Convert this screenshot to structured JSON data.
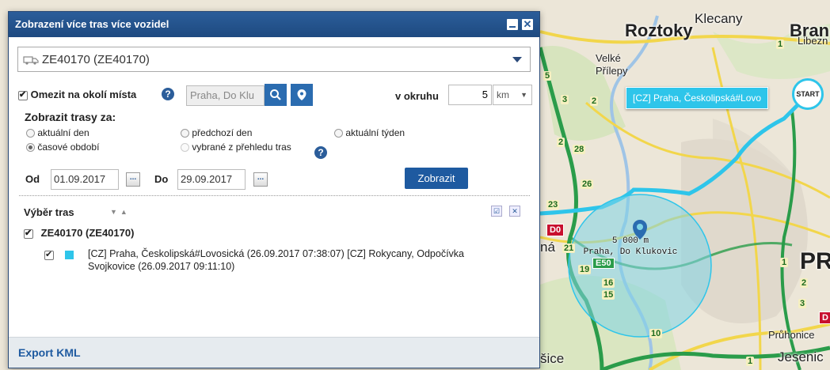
{
  "map": {
    "labels": {
      "roztoky": "Roztoky",
      "klecany": "Klecany",
      "libeznice": "Libezn",
      "bran": "Bran",
      "velke_prilepy_1": "Velké",
      "velke_prilepy_2": "Přílepy",
      "praha_big": "PR",
      "pruhonice": "Průhonice",
      "jesenice": "Jesenic",
      "sice": "šice",
      "na": "ná"
    },
    "road_numbers": [
      "5",
      "3",
      "2",
      "1",
      "28",
      "2",
      "26",
      "23",
      "21",
      "19",
      "16",
      "15",
      "10",
      "1",
      "2",
      "1",
      "3"
    ],
    "badges": {
      "d0": "D0",
      "d_right": "D",
      "e50": "E50"
    },
    "route_tooltip": "[CZ] Praha, Českolipská#Lovo",
    "start_marker": "START",
    "radius_label_line1": "5 000 m",
    "radius_label_line2": "Praha, Do Klukovic",
    "colors": {
      "route": "#2ec5ea",
      "circle_fill": "#7fd4e6",
      "road_yellow": "#f2d64b",
      "road_green": "#2a9c4a"
    }
  },
  "dialog": {
    "title": "Zobrazení více tras více vozidel",
    "vehicle_select": {
      "value": "ZE40170 (ZE40170)",
      "icon": "truck-icon"
    },
    "limit_area": {
      "label": "Omezit na okolí místa",
      "checked": true
    },
    "place_input": {
      "value": "Praha, Do Klu",
      "placeholder": ""
    },
    "radius_label": "v okruhu",
    "radius_value": "5",
    "unit": "km",
    "show_routes_label": "Zobrazit trasy za:",
    "options": {
      "current_day": "aktuální den",
      "previous_day": "předchozí den",
      "current_week": "aktuální týden",
      "time_period": "časové období",
      "selected_overview": "vybrané z přehledu tras"
    },
    "from_label": "Od",
    "from_date": "01.09.2017",
    "to_label": "Do",
    "to_date": "29.09.2017",
    "dots": "...",
    "show_button": "Zobrazit",
    "route_selection_label": "Výběr tras",
    "vehicle_group": "ZE40170 (ZE40170)",
    "route_item_line1": "[CZ] Praha, Českolipská#Lovosická (26.09.2017 07:38:07) [CZ] Rokycany, Odpočívka",
    "route_item_line2": "Svojkovice (26.09.2017 09:11:10)",
    "route_color": "#2ec5ea",
    "export_label": "Export KML"
  }
}
